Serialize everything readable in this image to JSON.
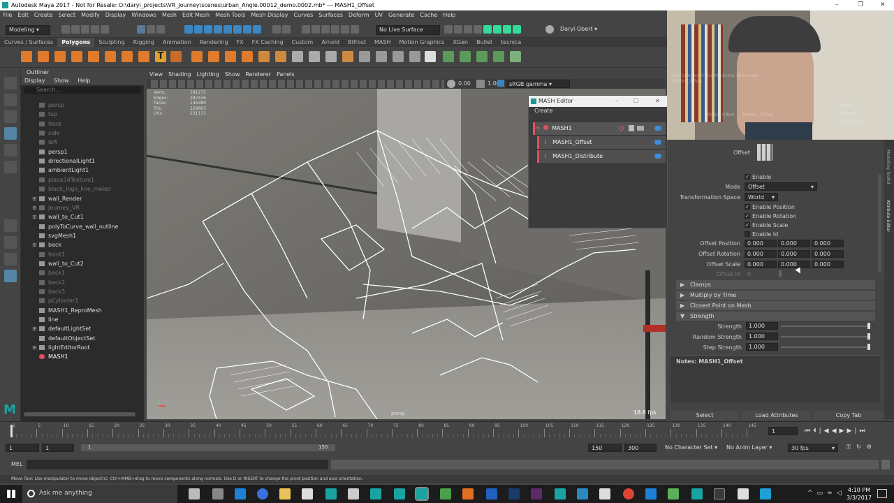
{
  "window": {
    "title": "Autodesk Maya 2017 - Not for Resale: O:\\daryl_projects\\VR_Journey\\scenes\\urban_Angle.00012_demo.0002.mb*  ---  MASH1_Offset",
    "controls": [
      "–",
      "❐",
      "✕"
    ]
  },
  "menubar": [
    "File",
    "Edit",
    "Create",
    "Select",
    "Modify",
    "Display",
    "Windows",
    "Mesh",
    "Edit Mesh",
    "Mesh Tools",
    "Mesh Display",
    "Curves",
    "Surfaces",
    "Deform",
    "UV",
    "Generate",
    "Cache",
    "Help"
  ],
  "statusline": {
    "menuset": "Modeling",
    "live_surface": "No Live Surface",
    "user": "Daryl Obert"
  },
  "shelf_tabs": [
    {
      "label": "Curves / Surfaces",
      "active": false
    },
    {
      "label": "Polygons",
      "active": true
    },
    {
      "label": "Sculpting",
      "active": false
    },
    {
      "label": "Rigging",
      "active": false
    },
    {
      "label": "Animation",
      "active": false
    },
    {
      "label": "Rendering",
      "active": false
    },
    {
      "label": "FX",
      "active": false
    },
    {
      "label": "FX Caching",
      "active": false
    },
    {
      "label": "Custom",
      "active": false
    },
    {
      "label": "Arnold",
      "active": false
    },
    {
      "label": "Bifrost",
      "active": false
    },
    {
      "label": "MASH",
      "active": false
    },
    {
      "label": "Motion Graphics",
      "active": false
    },
    {
      "label": "XGen",
      "active": false
    },
    {
      "label": "Bullet",
      "active": false
    },
    {
      "label": "tecnica",
      "active": false
    }
  ],
  "outliner": {
    "title": "Outliner",
    "menu": [
      "Display",
      "Show",
      "Help"
    ],
    "search_placeholder": "Search...",
    "items": [
      {
        "label": "persp",
        "dim": true,
        "exp": ""
      },
      {
        "label": "top",
        "dim": true,
        "exp": ""
      },
      {
        "label": "front",
        "dim": true,
        "exp": ""
      },
      {
        "label": "side",
        "dim": true,
        "exp": ""
      },
      {
        "label": "left",
        "dim": true,
        "exp": ""
      },
      {
        "label": "persp1",
        "dim": false,
        "exp": ""
      },
      {
        "label": "directionalLight1",
        "dim": false,
        "exp": ""
      },
      {
        "label": "ambientLight1",
        "dim": false,
        "exp": ""
      },
      {
        "label": "place3dTexture1",
        "dim": true,
        "exp": ""
      },
      {
        "label": "black_logo_line_maker",
        "dim": true,
        "exp": ""
      },
      {
        "label": "wall_Render",
        "dim": false,
        "exp": "⊞"
      },
      {
        "label": "Journey_VR",
        "dim": true,
        "exp": "⊞"
      },
      {
        "label": "wall_to_Cut1",
        "dim": false,
        "exp": "⊞"
      },
      {
        "label": "polyToCurve_wall_outline",
        "dim": false,
        "exp": ""
      },
      {
        "label": "svgMesh1",
        "dim": false,
        "exp": ""
      },
      {
        "label": "back",
        "dim": false,
        "exp": "⊞"
      },
      {
        "label": "front1",
        "dim": true,
        "exp": ""
      },
      {
        "label": "wall_to_Cut2",
        "dim": false,
        "exp": ""
      },
      {
        "label": "back1",
        "dim": true,
        "exp": ""
      },
      {
        "label": "back2",
        "dim": true,
        "exp": ""
      },
      {
        "label": "back3",
        "dim": true,
        "exp": ""
      },
      {
        "label": "pCylinder1",
        "dim": true,
        "exp": ""
      },
      {
        "label": "MASH1_ReproMesh",
        "dim": false,
        "exp": ""
      },
      {
        "label": "line",
        "dim": false,
        "exp": ""
      },
      {
        "label": "defaultLightSet",
        "dim": false,
        "exp": "⊞"
      },
      {
        "label": "defaultObjectSet",
        "dim": false,
        "exp": ""
      },
      {
        "label": "lightEditorRoot",
        "dim": false,
        "exp": "⊞"
      },
      {
        "label": "MASH1",
        "dim": false,
        "exp": ""
      }
    ]
  },
  "viewport": {
    "menu": [
      "View",
      "Shading",
      "Lighting",
      "Show",
      "Renderer",
      "Panels"
    ],
    "exposure": "0.00",
    "gamma": "1.00",
    "color_space": "sRGB gamma",
    "hud_labels": [
      "Verts:",
      "Edges:",
      "Faces:",
      "Tris:",
      "UVs:"
    ],
    "hud_values": [
      "181272",
      "282436",
      "146389",
      "229663",
      "231131"
    ],
    "camera": "persp",
    "fps": "18.8 fps"
  },
  "mash_editor": {
    "title": "MASH Editor",
    "create": "Create",
    "nodes": [
      "MASH1",
      "MASH1_Offset",
      "MASH1_Distribute"
    ]
  },
  "attribute_editor": {
    "node_label": "Offset",
    "enable": "Enable",
    "mode_label": "Mode",
    "mode_value": "Offset",
    "space_label": "Transformation Space",
    "space_value": "World",
    "checks": [
      "Enable Position",
      "Enable Rotation",
      "Enable Scale",
      "Enable Id"
    ],
    "offset_rows": [
      {
        "label": "Offset Position",
        "values": [
          "0.000",
          "0.000",
          "0.000"
        ]
      },
      {
        "label": "Offset Rotation",
        "values": [
          "0.000",
          "0.000",
          "0.000"
        ]
      },
      {
        "label": "Offset Scale",
        "values": [
          "0.000",
          "0.000",
          "0.000"
        ]
      }
    ],
    "offset_id_label": "Offset Id",
    "offset_id_value": "0",
    "sections": [
      "Clamps",
      "Multiply by Time",
      "Closest Point on Mesh",
      "Strength"
    ],
    "strength_rows": [
      {
        "label": "Strength",
        "value": "1.000"
      },
      {
        "label": "Random Strength",
        "value": "1.000"
      },
      {
        "label": "Step Strength",
        "value": "1.000"
      }
    ],
    "notes": "Notes: MASH1_Offset",
    "buttons": [
      "Select",
      "Load Attributes",
      "Copy Tab"
    ],
    "side_tabs": [
      "Modelling Toolkit",
      "Attribute Editor"
    ]
  },
  "webcam_overlay": {
    "labels": [
      "List",
      "Selected",
      "Focus",
      "Attributes",
      "Show",
      "Help",
      "MASH1_Offset",
      "Focus",
      "Presets",
      "Show",
      "Hide",
      "MASH_Offset",
      "MASH1_Offset"
    ]
  },
  "timeline": {
    "ticks": [
      "1",
      "5",
      "10",
      "15",
      "20",
      "25",
      "30",
      "35",
      "40",
      "45",
      "50",
      "55",
      "60",
      "65",
      "70",
      "75",
      "80",
      "85",
      "90",
      "95",
      "100",
      "105",
      "110",
      "115",
      "120",
      "125",
      "130",
      "135",
      "140",
      "145"
    ],
    "current_frame": "1"
  },
  "range": {
    "start": "1",
    "start_inner": "1",
    "slider_start": "1",
    "slider_end": "150",
    "end_inner": "150",
    "end": "300",
    "char_set": "No Character Set",
    "anim_layer": "No Anim Layer",
    "fps": "30 fps"
  },
  "mel": {
    "label": "MEL"
  },
  "help_line": "Move Tool: Use manipulator to move object(s). Ctrl+MMB+drag to move components along normals. Use D or INSERT to change the pivot position and axis orientation.",
  "taskbar": {
    "search": "Ask me anything",
    "time": "4:10 PM",
    "date": "3/3/2017"
  }
}
